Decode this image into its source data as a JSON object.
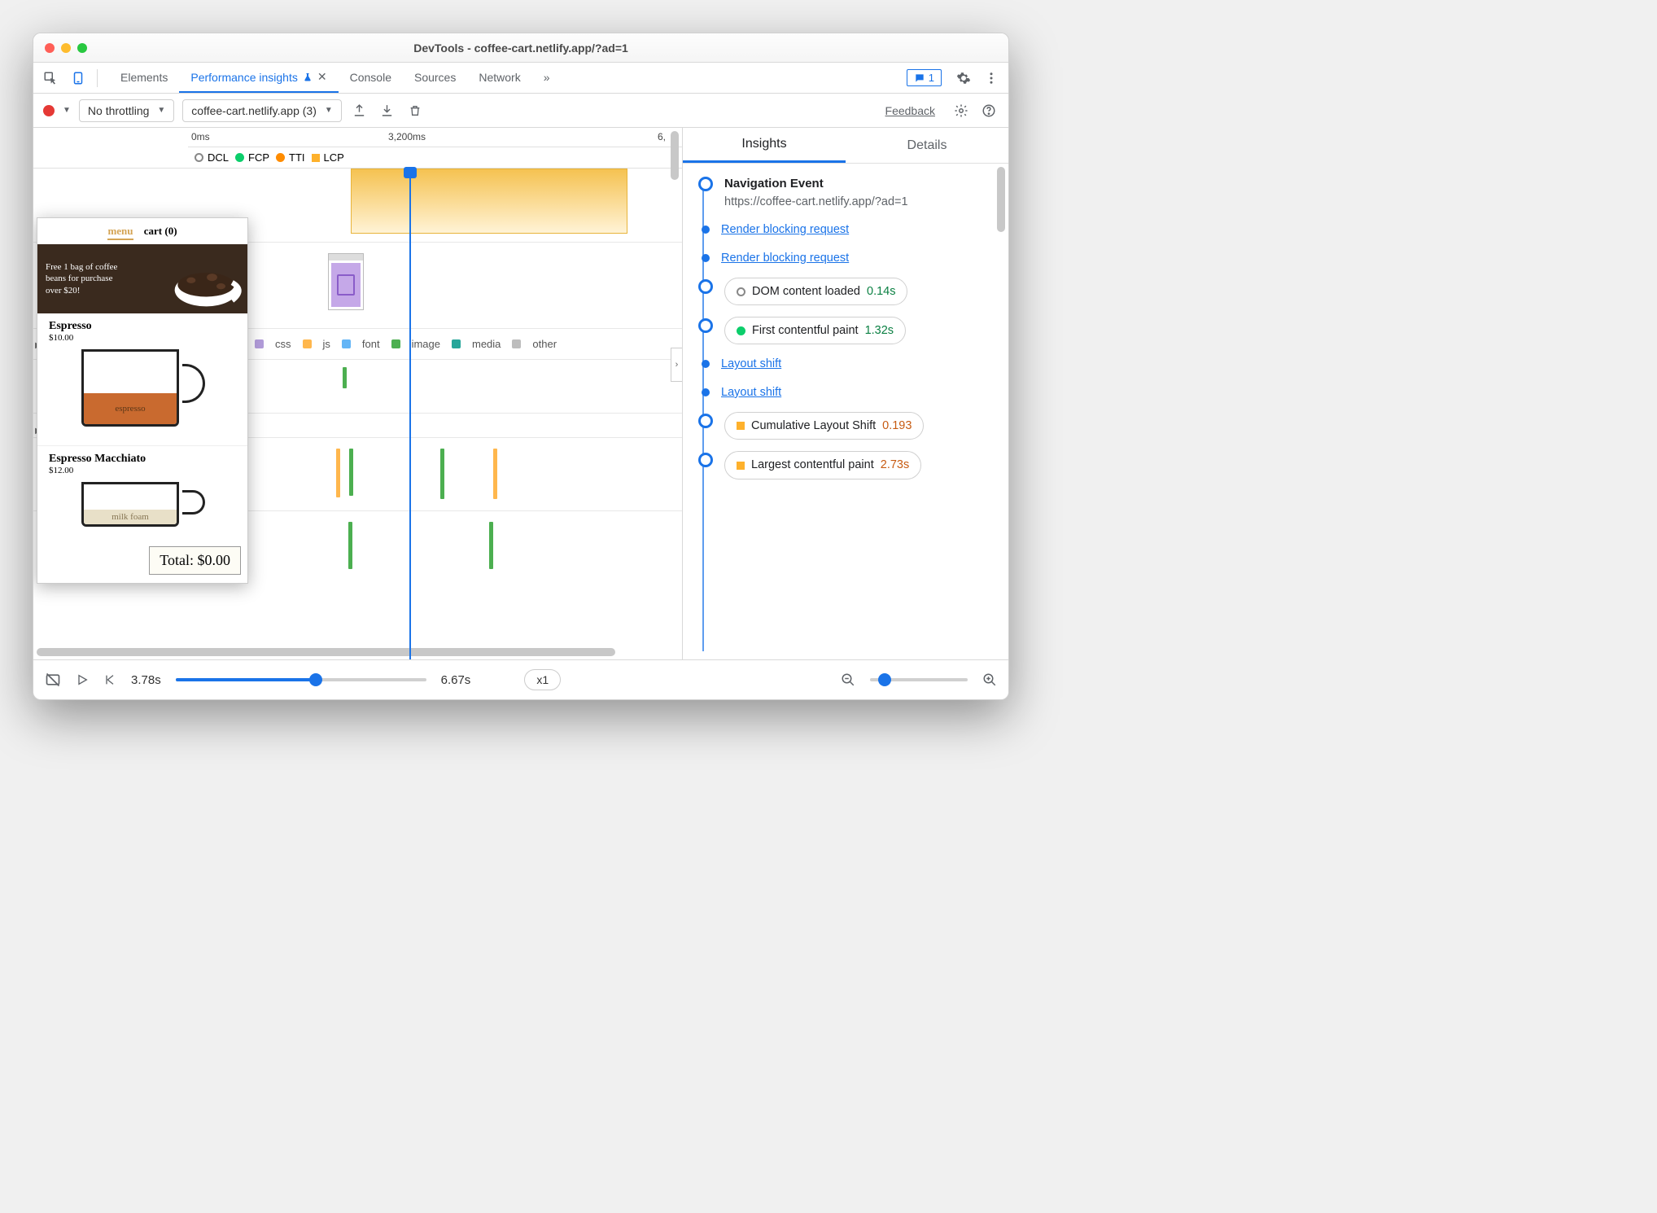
{
  "window": {
    "title": "DevTools - coffee-cart.netlify.app/?ad=1"
  },
  "tabs": {
    "elements": "Elements",
    "perf": "Performance insights",
    "console": "Console",
    "sources": "Sources",
    "network": "Network",
    "overflow": "»",
    "issues_count": "1"
  },
  "toolbar": {
    "throttle": "No throttling",
    "recording_select": "coffee-cart.netlify.app (3)",
    "feedback": "Feedback"
  },
  "ruler": {
    "t0": "0ms",
    "t1": "3,200ms",
    "t2": "6,"
  },
  "markers": {
    "dcl": "DCL",
    "fcp": "FCP",
    "tti": "TTI",
    "lcp": "LCP"
  },
  "legend": {
    "css": "css",
    "js": "js",
    "font": "font",
    "image": "image",
    "media": "media",
    "other": "other"
  },
  "preview": {
    "menu": "menu",
    "cart": "cart (0)",
    "banner": "Free 1 bag of coffee beans for purchase over $20!",
    "item1": "Espresso",
    "price1": "$10.00",
    "fill1": "espresso",
    "item2": "Espresso Macchiato",
    "price2": "$12.00",
    "foam": "milk foam",
    "total": "Total: $0.00"
  },
  "insights": {
    "tab_insights": "Insights",
    "tab_details": "Details",
    "nav_title": "Navigation Event",
    "nav_url": "https://coffee-cart.netlify.app/?ad=1",
    "render_block": "Render blocking request",
    "dcl_label": "DOM content loaded",
    "dcl_val": "0.14s",
    "fcp_label": "First contentful paint",
    "fcp_val": "1.32s",
    "layout_shift": "Layout shift",
    "cls_label": "Cumulative Layout Shift",
    "cls_val": "0.193",
    "lcp_label": "Largest contentful paint",
    "lcp_val": "2.73s"
  },
  "bottom": {
    "time": "3.78s",
    "end": "6.67s",
    "rate": "x1"
  }
}
